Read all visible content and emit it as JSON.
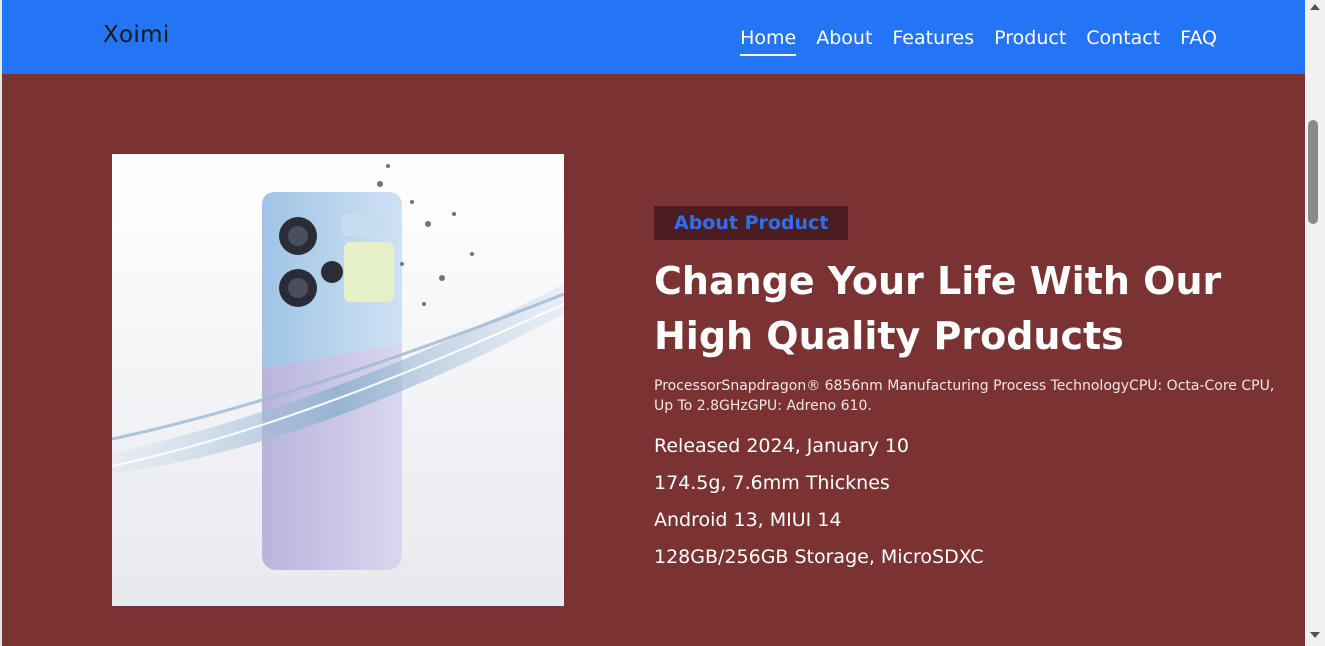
{
  "header": {
    "brand": "Xoimi",
    "nav": [
      {
        "label": "Home",
        "active": true
      },
      {
        "label": "About"
      },
      {
        "label": "Features"
      },
      {
        "label": "Product"
      },
      {
        "label": "Contact"
      },
      {
        "label": "FAQ"
      }
    ]
  },
  "hero": {
    "tag": "About Product",
    "headline": "Change Your Life With Our High Quality Products",
    "description": "ProcessorSnapdragon® 6856nm Manufacturing Process TechnologyCPU: Octa-Core CPU, Up To 2.8GHzGPU: Adreno 610.",
    "specs": [
      "Released 2024, January 10",
      "174.5g, 7.6mm Thicknes",
      "Android 13, MIUI 14",
      "128GB/256GB Storage, MicroSDXC"
    ]
  },
  "colors": {
    "navbar": "#2475f5",
    "hero_bg": "#7a3232",
    "tag_bg": "#4a1e21",
    "tag_text": "#2d6ff0"
  }
}
